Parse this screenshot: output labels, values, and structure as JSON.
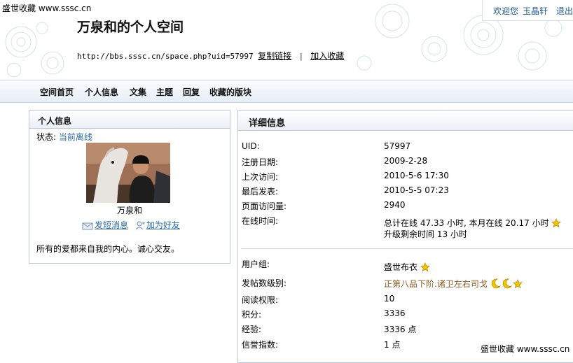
{
  "watermark": "盛世收藏 www.sssc.cn",
  "topbar": {
    "welcome": "欢迎您",
    "username": "玉晶轩",
    "logout": "退出"
  },
  "space_title": "万泉和的个人空间",
  "url_line": {
    "url": "http://bbs.sssc.cn/space.php?uid=57997",
    "copy_link": "复制链接",
    "separator": "|",
    "add_fav": "加入收藏"
  },
  "nav": [
    "空间首页",
    "个人信息",
    "文集",
    "主题",
    "回复",
    "收藏的版块"
  ],
  "left_panel": {
    "title": "个人信息",
    "status_label": "状态:",
    "status_value": "当前离线",
    "name": "万泉和",
    "send_message": "发短消息",
    "add_friend": "加为好友",
    "motto": "所有的爱都来自我的内心。诚心交友。"
  },
  "right_panel": {
    "title": "详细信息",
    "rows": [
      {
        "key": "UID:",
        "value": "57997"
      },
      {
        "key": "注册日期:",
        "value": "2009-2-28"
      },
      {
        "key": "上次访问:",
        "value": "2010-5-6 17:30"
      },
      {
        "key": "最后发表:",
        "value": "2010-5-5 07:23"
      },
      {
        "key": "页面访问量:",
        "value": "2940"
      },
      {
        "key": "在线时间:",
        "value": "总计在线  47.33 小时, 本月在线  20.17 小时",
        "value2": "升级剩余时间  13 小时"
      },
      {
        "key": "用户组:",
        "value": "盛世布衣"
      },
      {
        "key": "发帖数级别:",
        "value": "正第八品下阶.诸卫左右司戈"
      },
      {
        "key": "阅读权限:",
        "value": "10"
      },
      {
        "key": "积分:",
        "value": "3336"
      },
      {
        "key": "经验:",
        "value": "3336 点"
      },
      {
        "key": "信誉指数:",
        "value": "1 点"
      }
    ]
  },
  "colors": {
    "link": "#2a69a8",
    "rank": "#8a5a22",
    "border": "#b8c9da",
    "star": "#f5c400"
  },
  "icons": [
    "star-icon",
    "moon-icon",
    "message-icon",
    "add-friend-icon"
  ]
}
